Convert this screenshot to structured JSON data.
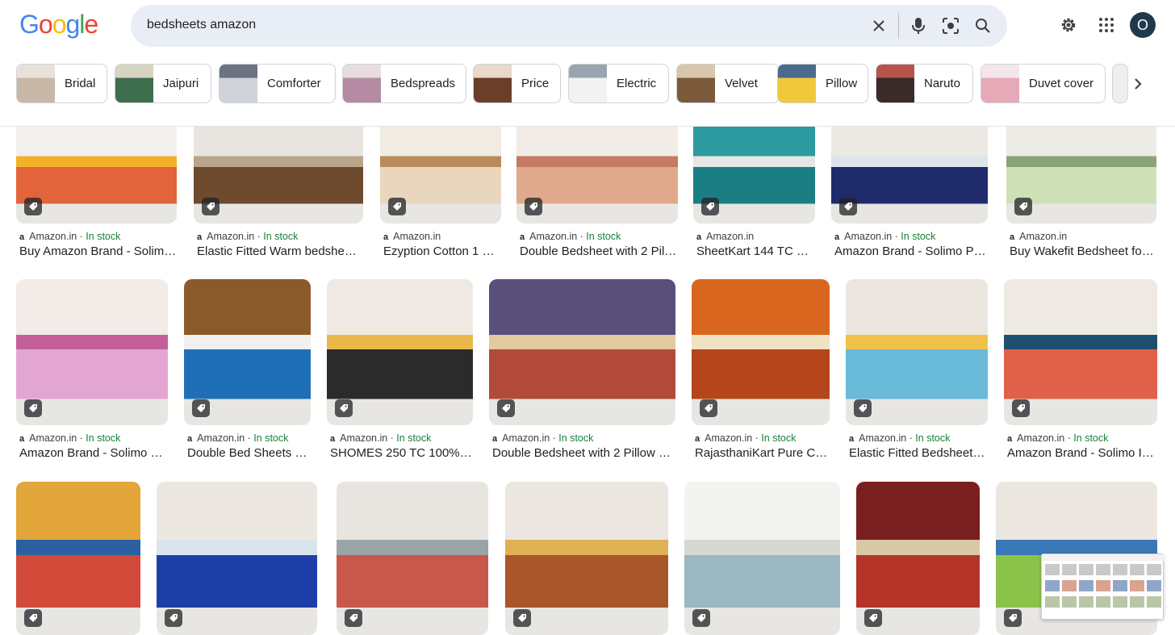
{
  "brand": {
    "logo_letters": [
      "G",
      "o",
      "o",
      "g",
      "l",
      "e"
    ],
    "logo_colors": [
      "#4285f4",
      "#ea4335",
      "#fbbc05",
      "#4285f4",
      "#34a853",
      "#ea4335"
    ]
  },
  "search": {
    "query": "bedsheets amazon"
  },
  "account": {
    "initial": "O"
  },
  "icons": {
    "clear": "close-icon",
    "voice": "mic-icon",
    "lens": "camera-icon",
    "search": "search-icon",
    "settings": "gear-icon",
    "apps": "apps-grid-icon",
    "next": "chevron-right-icon",
    "tag": "shopping-tag-icon"
  },
  "chips": [
    {
      "label": "Bridal",
      "colors": [
        "#c9b8a8",
        "#e8e1d9"
      ]
    },
    {
      "label": "Jaipuri",
      "colors": [
        "#3f6e4f",
        "#d8d4c2"
      ]
    },
    {
      "label": "Comforter",
      "colors": [
        "#cfd3d8",
        "#6b7280"
      ]
    },
    {
      "label": "Bedspreads",
      "colors": [
        "#b58aa3",
        "#e7dde0"
      ]
    },
    {
      "label": "Price",
      "colors": [
        "#6b3e2a",
        "#e8d9c8"
      ]
    },
    {
      "label": "Electric",
      "colors": [
        "#f2f2f2",
        "#9aa4b1"
      ]
    },
    {
      "label": "Velvet",
      "colors": [
        "#7a5a3a",
        "#d9c7ab"
      ]
    },
    {
      "label": "Pillow",
      "colors": [
        "#f0c93a",
        "#4a6b8c"
      ]
    },
    {
      "label": "Naruto",
      "colors": [
        "#3a2a2a",
        "#b5544a"
      ]
    },
    {
      "label": "Duvet cover",
      "colors": [
        "#e6a9b8",
        "#f4e6ea"
      ]
    }
  ],
  "results": [
    {
      "source": "Amazon.in",
      "stock": "In stock",
      "title": "Buy Amazon Brand - Solimo…",
      "colors": [
        "#f2f0ec",
        "#e2643a",
        "#f3b12a"
      ]
    },
    {
      "source": "Amazon.in",
      "stock": "In stock",
      "title": "Elastic Fitted Warm bedshee…",
      "colors": [
        "#e9e6e1",
        "#6e4b2e",
        "#b9a589"
      ]
    },
    {
      "source": "Amazon.in",
      "stock": "",
      "title": "Ezyption Cotton 1 …",
      "colors": [
        "#f1ece3",
        "#e8d7bd",
        "#b98a5a"
      ]
    },
    {
      "source": "Amazon.in",
      "stock": "In stock",
      "title": "Double Bedsheet with 2 Pil…",
      "colors": [
        "#f1ece6",
        "#e0a98c",
        "#c57a63"
      ]
    },
    {
      "source": "Amazon.in",
      "stock": "",
      "title": "SheetKart 144 TC …",
      "colors": [
        "#2d9aa0",
        "#1a7e84",
        "#e6e6e6"
      ]
    },
    {
      "source": "Amazon.in",
      "stock": "In stock",
      "title": "Amazon Brand - Solimo P…",
      "colors": [
        "#ece8e4",
        "#1f2b6b",
        "#dfe3ea"
      ]
    },
    {
      "source": "Amazon.in",
      "stock": "",
      "title": "Buy Wakefit Bedsheet for…",
      "colors": [
        "#ecebe6",
        "#cfe0b6",
        "#8aa37a"
      ]
    },
    {
      "source": "Amazon.in",
      "stock": "In stock",
      "title": "Amazon Brand - Solimo …",
      "colors": [
        "#f1ece8",
        "#e3a6d2",
        "#c55f9c"
      ]
    },
    {
      "source": "Amazon.in",
      "stock": "In stock",
      "title": "Double Bed Sheets …",
      "colors": [
        "#8b5a2b",
        "#1f6fb8",
        "#f0f0f0"
      ]
    },
    {
      "source": "Amazon.in",
      "stock": "In stock",
      "title": "SHOMES 250 TC 100%…",
      "colors": [
        "#eeeae3",
        "#2b2b2b",
        "#e8b94a"
      ]
    },
    {
      "source": "Amazon.in",
      "stock": "In stock",
      "title": "Double Bedsheet with 2 Pillow …",
      "colors": [
        "#5a4e7a",
        "#b24a3a",
        "#e3c9a0"
      ]
    },
    {
      "source": "Amazon.in",
      "stock": "In stock",
      "title": "RajasthaniKart Pure C…",
      "colors": [
        "#d9661f",
        "#b5451b",
        "#f2e2c4"
      ]
    },
    {
      "source": "Amazon.in",
      "stock": "In stock",
      "title": "Elastic Fitted Bedsheet…",
      "colors": [
        "#ebe6df",
        "#69b9d8",
        "#f0c24a"
      ]
    },
    {
      "source": "Amazon.in",
      "stock": "In stock",
      "title": "Amazon Brand - Solimo I…",
      "colors": [
        "#efe9e4",
        "#e0604a",
        "#1f4f6e"
      ]
    },
    {
      "source": "",
      "stock": "",
      "title": "",
      "colors": [
        "#e2a63a",
        "#d24a3a",
        "#2a5fa0"
      ]
    },
    {
      "source": "",
      "stock": "",
      "title": "",
      "colors": [
        "#ece7e1",
        "#1f3fa8",
        "#d9e4ec"
      ]
    },
    {
      "source": "",
      "stock": "",
      "title": "",
      "colors": [
        "#e8e4df",
        "#c8584a",
        "#9aa3a8"
      ]
    },
    {
      "source": "",
      "stock": "",
      "title": "",
      "colors": [
        "#ece6e0",
        "#a8562a",
        "#e0b054"
      ]
    },
    {
      "source": "",
      "stock": "",
      "title": "",
      "colors": [
        "#f3f3f0",
        "#9ab7c2",
        "#d5d9d2"
      ]
    },
    {
      "source": "",
      "stock": "",
      "title": "",
      "colors": [
        "#7a1f1f",
        "#b5342a",
        "#d8c9a6"
      ]
    },
    {
      "source": "",
      "stock": "",
      "title": "",
      "colors": [
        "#ece7e1",
        "#8bc34a",
        "#3a78b8"
      ]
    }
  ]
}
